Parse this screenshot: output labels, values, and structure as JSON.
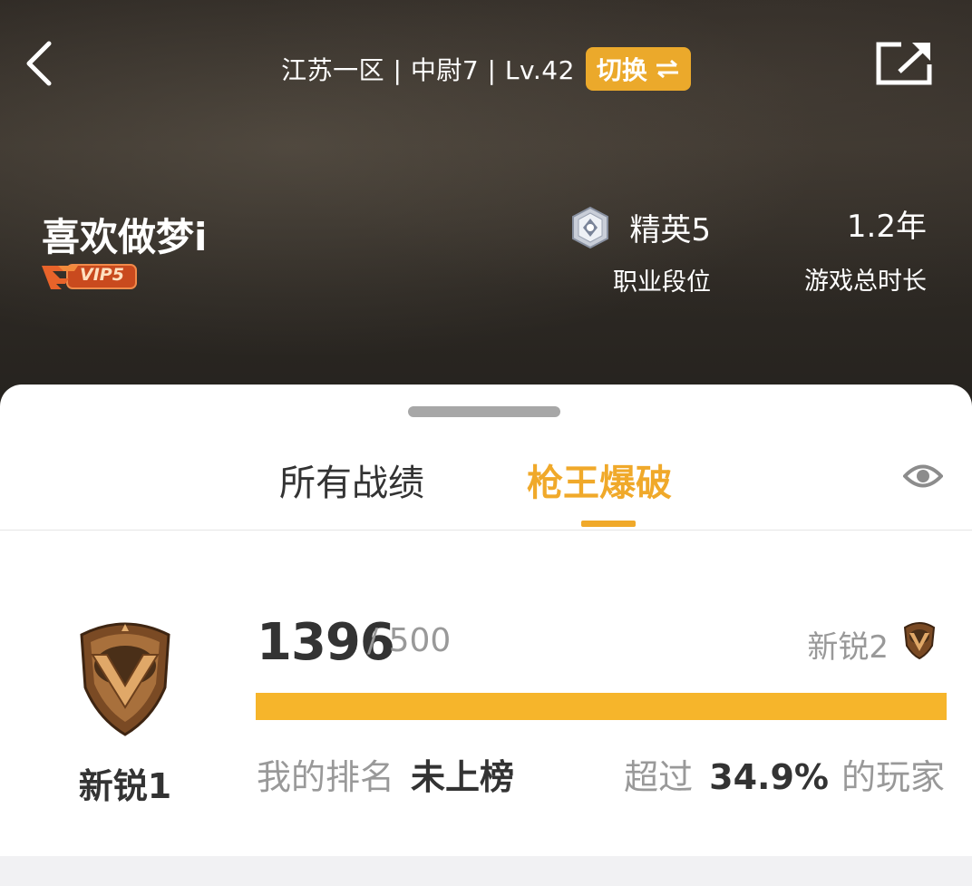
{
  "header": {
    "server_line": "江苏一区 | 中尉7 | Lv.42",
    "switch_label": "切换",
    "username": "喜欢做梦i",
    "vip_label": "VIP5",
    "rank": {
      "value": "精英5",
      "label": "职业段位"
    },
    "playtime": {
      "value": "1.2年",
      "label": "游戏总时长"
    }
  },
  "tabs": [
    {
      "label": "所有战绩",
      "active": false
    },
    {
      "label": "枪王爆破",
      "active": true
    }
  ],
  "tier": {
    "current_name": "新锐1",
    "score": "1396",
    "score_divider": "/ 500",
    "next_name": "新锐2",
    "progress_fraction": 1.0,
    "my_rank_label": "我的排名",
    "my_rank_value": "未上榜",
    "beat_prefix": "超过",
    "beat_percent": "34.9%",
    "beat_suffix": "的玩家"
  },
  "colors": {
    "accent": "#f0a92a",
    "progress": "#f6b52b",
    "header_bg": "#2e2924"
  },
  "icons": [
    "back-arrow-icon",
    "switch-arrows-icon",
    "share-icon",
    "diamond-rank-icon",
    "eye-icon",
    "bronze-shield-icon"
  ]
}
